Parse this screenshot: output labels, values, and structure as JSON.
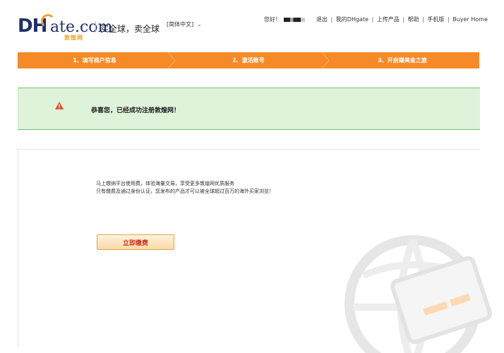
{
  "header": {
    "logo": {
      "dh": "DH",
      "gate": "ate.com",
      "sub": "敦煌网"
    },
    "tagline": "买全球，卖全球",
    "language": "[简体中文]",
    "greeting": "您好！",
    "links": [
      "退出",
      "我的DHgate",
      "上传产品",
      "帮助",
      "手机版",
      "Buyer Home"
    ],
    "link_separator": "|"
  },
  "steps": [
    {
      "label": "1、填写商户信息"
    },
    {
      "label": "2、激活账号"
    },
    {
      "label": "3、开启赚美金之旅"
    }
  ],
  "banner": {
    "icon": "warning-icon",
    "message": "恭喜您，已经成功注册敦煌网！"
  },
  "content": {
    "line1": "马上缴纳平台使用费，体验海量交易，享受更多敦煌网优质服务",
    "line2": "只有缴费及通过身份认证，您发布的产品才可以被全球超过百万的海外买家浏览！",
    "pay_button": "立即缴费",
    "watermark": "globe-card-watermark-icon"
  },
  "colors": {
    "accent": "#f68a27",
    "banner_bg": "#dff3da",
    "banner_border": "#6fbf6f",
    "button_text": "#c9301d"
  }
}
